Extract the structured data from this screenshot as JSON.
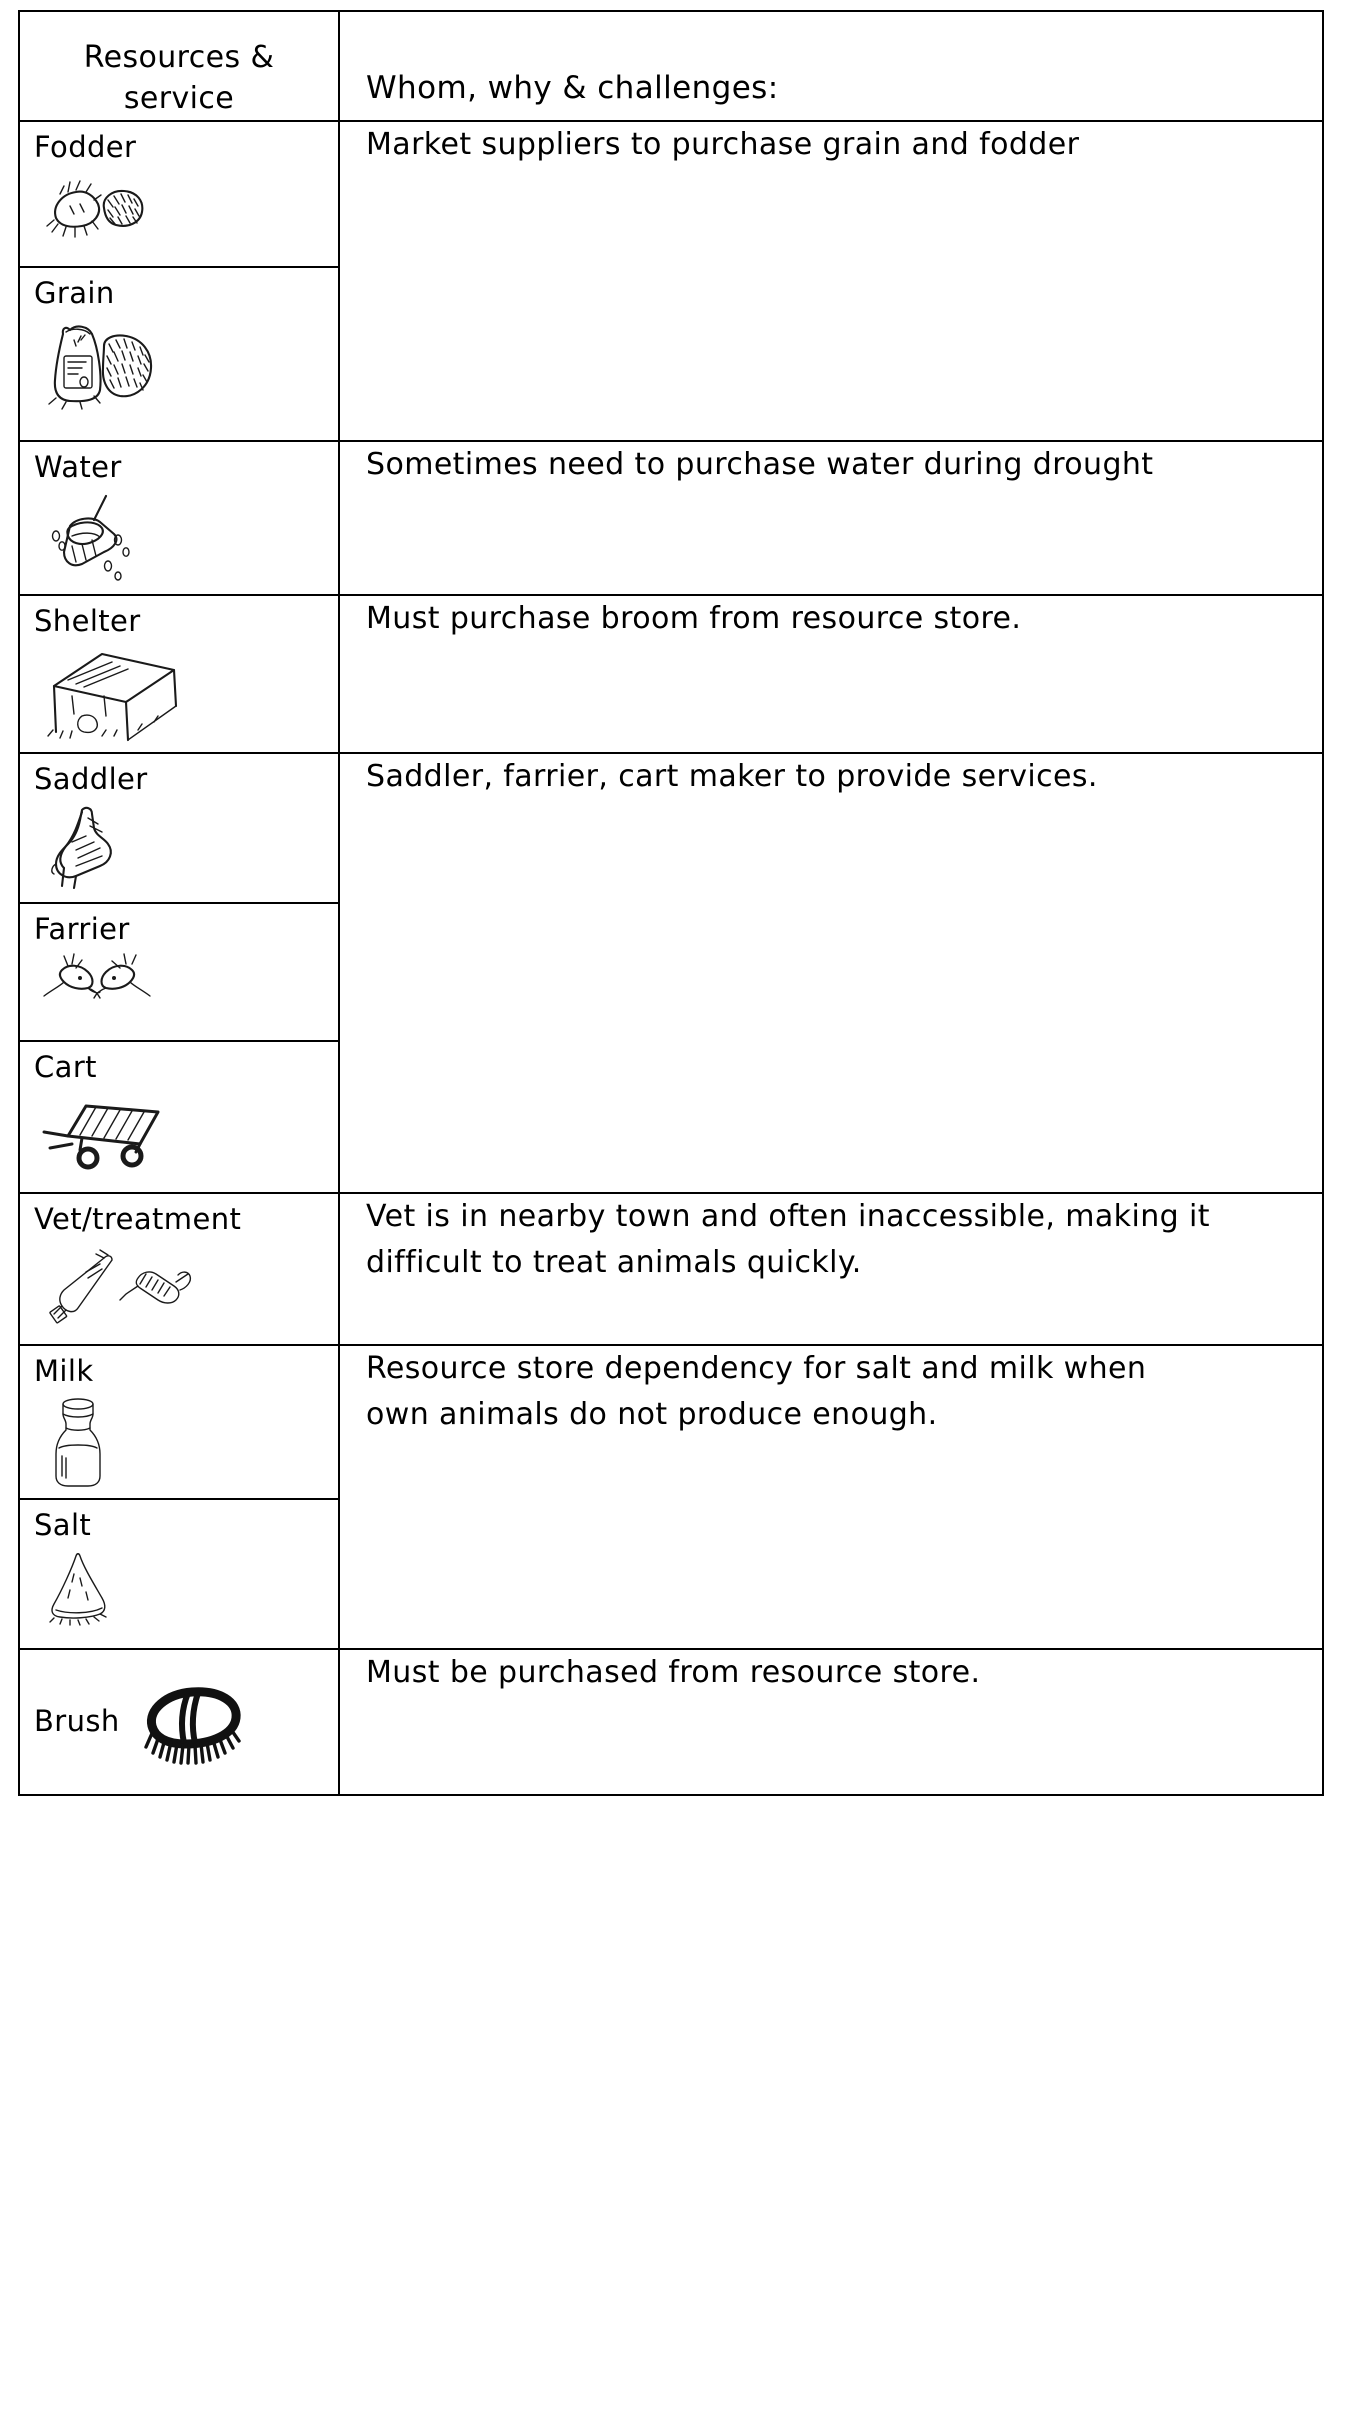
{
  "table": {
    "headers": {
      "col1": "Resources & service",
      "col2": "Whom, why & challenges:"
    },
    "rows": [
      {
        "label": "Fodder",
        "icon": "hay-bundle-icon"
      },
      {
        "label": "Grain",
        "icon": "grain-sack-icon"
      },
      {
        "label": "Water",
        "icon": "water-bucket-icon"
      },
      {
        "label": "Shelter",
        "icon": "shed-icon"
      },
      {
        "label": "Saddler",
        "icon": "saddle-icon"
      },
      {
        "label": "Farrier",
        "icon": "hoof-icon"
      },
      {
        "label": "Cart",
        "icon": "cart-icon"
      },
      {
        "label": "Vet/treatment",
        "icon": "medicine-syringe-icon"
      },
      {
        "label": "Milk",
        "icon": "milk-bottle-icon"
      },
      {
        "label": "Salt",
        "icon": "salt-pile-icon"
      },
      {
        "label": "Brush",
        "icon": "brush-icon"
      }
    ],
    "descriptions": {
      "fodder_grain": "Market suppliers to purchase grain and fodder",
      "water": "Sometimes need to purchase water during drought",
      "shelter": "Must purchase broom from resource store.",
      "saddler_farrier_cart": "Saddler, farrier, cart maker to provide services.",
      "vet": "Vet is in nearby town and often inaccessible, making it difficult to treat animals quickly.",
      "milk_salt": "Resource store dependency for salt and milk when own animals do not produce enough.",
      "brush": "Must be purchased from resource store."
    }
  },
  "colors": {
    "ink": "#1a1a1a",
    "border": "#000000",
    "background": "#ffffff"
  }
}
